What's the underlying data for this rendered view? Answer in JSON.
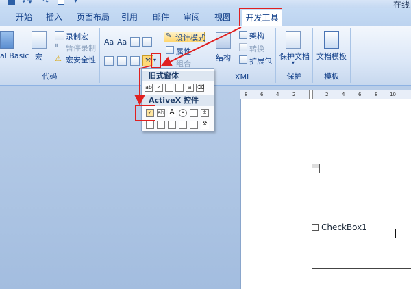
{
  "title_right": "在线",
  "tabs": [
    "开始",
    "插入",
    "页面布局",
    "引用",
    "邮件",
    "审阅",
    "视图",
    "开发工具"
  ],
  "ribbon": {
    "code": {
      "vb_label": "al Basic",
      "macro_label": "宏",
      "record_label": "录制宏",
      "pause_label": "暂停录制",
      "security_label": "宏安全性",
      "group_label": "代码"
    },
    "controls": {
      "design_mode_label": "设计模式",
      "properties_label": "属性",
      "group_combine_label": "组合"
    },
    "xml": {
      "structure_label": "结构",
      "schema_label": "架构",
      "transform_label": "转换",
      "expansion_label": "扩展包",
      "group_label": "XML"
    },
    "protect": {
      "protect_doc_label": "保护文档",
      "group_label": "保护"
    },
    "templates": {
      "doc_template_label": "文档模板",
      "group_label": "模板"
    }
  },
  "dropdown": {
    "legacy_header": "旧式窗体",
    "activex_header": "ActiveX 控件"
  },
  "document": {
    "checkbox_label": "CheckBox1"
  },
  "ruler_ticks": [
    "8",
    "6",
    "4",
    "2",
    "2",
    "4",
    "6",
    "8",
    "10"
  ],
  "colors": {
    "highlight_red": "#e02020",
    "ribbon_text": "#15428b"
  }
}
